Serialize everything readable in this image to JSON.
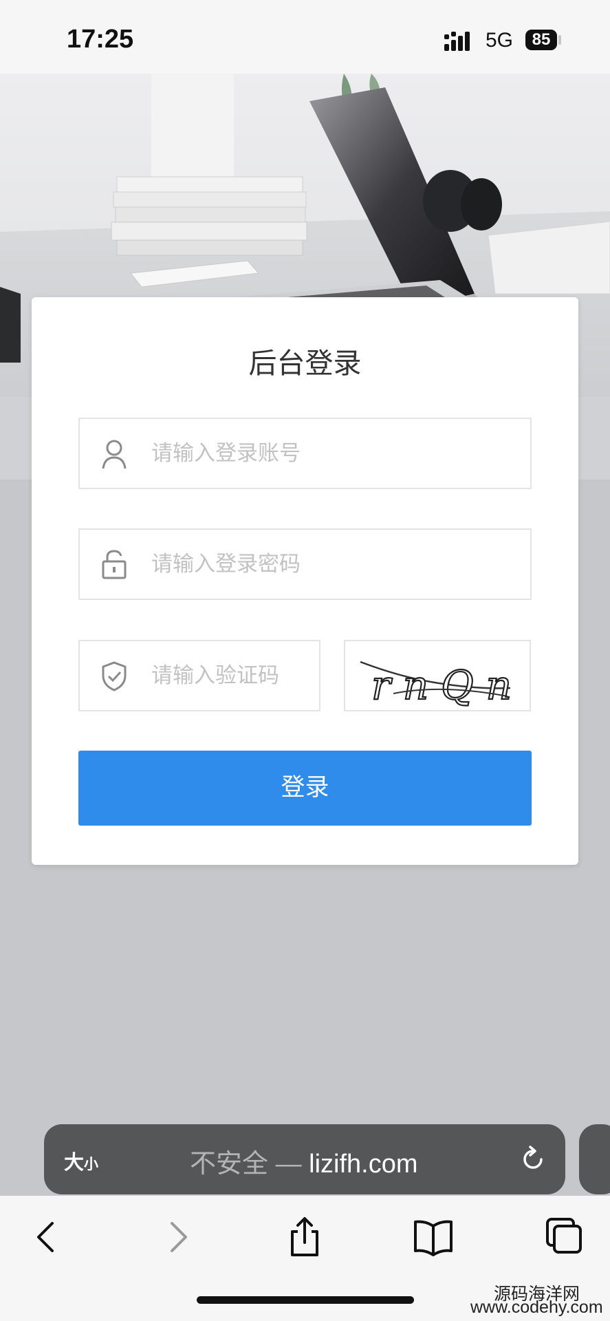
{
  "status_bar": {
    "time": "17:25",
    "network": "5G",
    "battery": "85"
  },
  "login_card": {
    "title": "后台登录",
    "username_placeholder": "请输入登录账号",
    "password_placeholder": "请输入登录密码",
    "captcha_placeholder": "请输入验证码",
    "captcha_text": "rnQn",
    "login_label": "登录"
  },
  "browser": {
    "text_size_label": "大",
    "text_size_small": "小",
    "insecure_label": "不安全",
    "separator": " — ",
    "domain": "lizifh.com"
  },
  "watermark": {
    "line1": "源码海洋网",
    "line2": "www.codehy.com"
  },
  "icons": [
    "signal-icon",
    "battery-icon",
    "user-icon",
    "lock-icon",
    "shield-check-icon",
    "reload-icon",
    "back-icon",
    "forward-icon",
    "share-icon",
    "bookmarks-icon",
    "tabs-icon"
  ],
  "colors": {
    "primary": "#2f8ceb",
    "background": "#c6c7ca",
    "card": "#ffffff",
    "urlbar": "#555658"
  }
}
